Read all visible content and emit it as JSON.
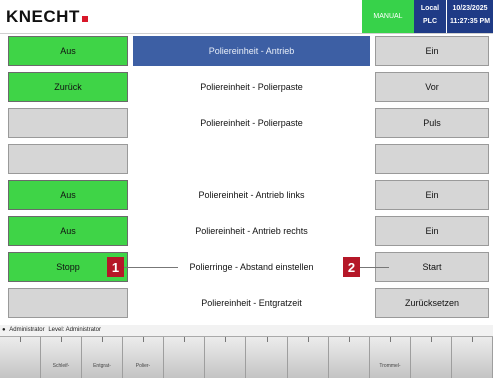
{
  "header": {
    "logo_text": "KNECHT",
    "mode": "MANUAL",
    "location_label": "Local",
    "location_value": "PLC",
    "date": "10/23/2025",
    "time": "11:27:35 PM"
  },
  "rows": [
    {
      "left": "Aus",
      "center": "Poliereinheit - Antrieb",
      "right": "Ein",
      "left_style": "green",
      "right_style": "gray",
      "highlight": true
    },
    {
      "left": "Zurück",
      "center": "Poliereinheit - Polierpaste",
      "right": "Vor",
      "left_style": "green",
      "right_style": "gray",
      "highlight": false
    },
    {
      "left": "",
      "center": "Poliereinheit - Polierpaste",
      "right": "Puls",
      "left_style": "gray",
      "right_style": "gray",
      "highlight": false
    },
    {
      "left": "",
      "center": "",
      "right": "",
      "left_style": "gray",
      "right_style": "gray",
      "highlight": false
    },
    {
      "left": "Aus",
      "center": "Poliereinheit - Antrieb links",
      "right": "Ein",
      "left_style": "green",
      "right_style": "gray",
      "highlight": false
    },
    {
      "left": "Aus",
      "center": "Poliereinheit - Antrieb rechts",
      "right": "Ein",
      "left_style": "green",
      "right_style": "gray",
      "highlight": false
    },
    {
      "left": "Stopp",
      "center": "Polierringe - Abstand einstellen",
      "right": "Start",
      "left_style": "green",
      "right_style": "gray",
      "highlight": false
    },
    {
      "left": "",
      "center": "Poliereinheit - Entgratzeit",
      "right": "Zurücksetzen",
      "left_style": "gray",
      "right_style": "gray",
      "highlight": false
    }
  ],
  "markers": {
    "left": "1",
    "right": "2"
  },
  "user_bar": {
    "user_label": "Administrator",
    "level_label": "Level: Administrator"
  },
  "footer_keys": [
    "",
    "Schleif-",
    "Entgrat-",
    "Polier-",
    "",
    "",
    "",
    "",
    "",
    "Trommel-",
    "",
    ""
  ],
  "colors": {
    "green": "#3fd447",
    "gray": "#d6d6d6",
    "highlight": "#3d5fa4",
    "marker": "#b51728"
  }
}
